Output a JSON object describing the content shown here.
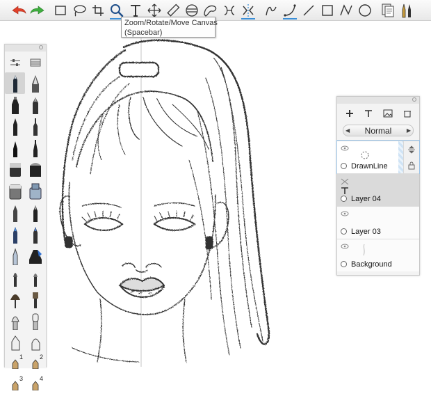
{
  "toolbar": {
    "tools": [
      {
        "name": "undo",
        "icon": "undo-arrow-icon"
      },
      {
        "name": "redo",
        "icon": "redo-arrow-icon"
      },
      {
        "name": "select-rectangle",
        "icon": "rectangle-select-icon"
      },
      {
        "name": "lasso",
        "icon": "lasso-icon"
      },
      {
        "name": "crop",
        "icon": "crop-icon"
      },
      {
        "name": "zoom",
        "icon": "magnifier-icon"
      },
      {
        "name": "text",
        "icon": "text-icon"
      },
      {
        "name": "transform",
        "icon": "move-arrows-icon"
      },
      {
        "name": "ruler",
        "icon": "ruler-icon"
      },
      {
        "name": "ellipse-guide",
        "icon": "ellipse-guide-icon"
      },
      {
        "name": "french-curve",
        "icon": "french-curve-icon"
      },
      {
        "name": "symmetry",
        "icon": "symmetry-icon"
      },
      {
        "name": "symmetry-active",
        "icon": "symmetry-x-icon"
      },
      {
        "name": "line",
        "icon": "freehand-line-icon"
      },
      {
        "name": "curve",
        "icon": "curve-icon"
      },
      {
        "name": "straight-line",
        "icon": "straight-line-icon"
      },
      {
        "name": "rectangle",
        "icon": "rectangle-icon"
      },
      {
        "name": "polyline",
        "icon": "polyline-icon"
      },
      {
        "name": "circle",
        "icon": "circle-icon"
      },
      {
        "name": "copy-paste",
        "icon": "copy-icon"
      },
      {
        "name": "brush-library",
        "icon": "brushes-icon"
      }
    ],
    "tooltip": {
      "line1": "Zoom/Rotate/Move Canvas",
      "line2": "(Spacebar)"
    }
  },
  "brush_panel": {
    "numbers": [
      "1",
      "2",
      "3",
      "4"
    ]
  },
  "layer_panel": {
    "blend_mode": "Normal",
    "layers": [
      {
        "name": "DrawnLine",
        "active": true
      },
      {
        "name": "Layer 04",
        "active": false
      },
      {
        "name": "Layer 03",
        "active": false
      },
      {
        "name": "Background",
        "active": false
      }
    ]
  },
  "colors": {
    "undo": "#e0402a",
    "redo": "#3fae3f",
    "accent": "#3a8fd8",
    "sketch": "#2b2b2b"
  }
}
